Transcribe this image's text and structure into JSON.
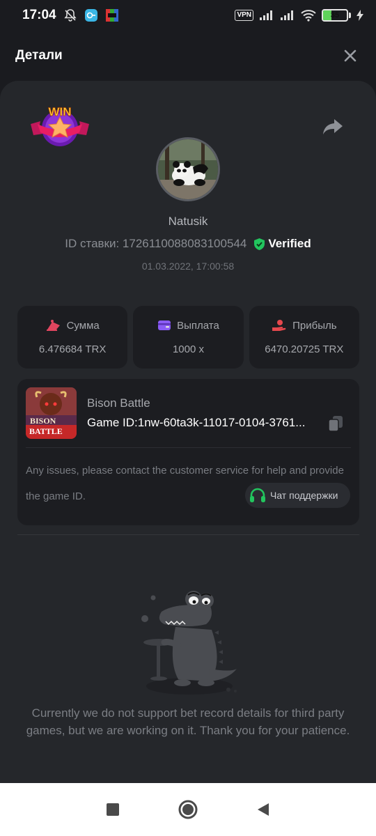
{
  "status_bar": {
    "time": "17:04",
    "vpn": "VPN",
    "battery": "35",
    "icons": [
      "mute-bell-icon",
      "app-notification-icon",
      "app-notification-icon",
      "signal-icon",
      "signal-icon",
      "wifi-icon",
      "battery-icon",
      "charging-icon"
    ]
  },
  "header": {
    "title": "Детали",
    "close_icon": "close-icon"
  },
  "badge": {
    "text": "WIN"
  },
  "profile": {
    "username": "Natusik",
    "bet_id_label": "ID ставки: 1726110088083100544",
    "verified": "Verified",
    "date": "01.03.2022, 17:00:58"
  },
  "stats": [
    {
      "label": "Сумма",
      "value": "6.476684 TRX",
      "icon": "cash-icon",
      "color": "#e0455f"
    },
    {
      "label": "Выплата",
      "value": "1000 x",
      "icon": "wallet-icon",
      "color": "#8b5cf6"
    },
    {
      "label": "Прибыль",
      "value": "6470.20725 TRX",
      "icon": "profit-hand-icon",
      "color": "#e5484d"
    }
  ],
  "game": {
    "name": "Bison Battle",
    "id_line": "Game ID:1nw-60ta3k-11017-0104-3761...",
    "thumb_text": [
      "BISON",
      "BATTLE"
    ],
    "issue_text": "Any issues, please contact the customer service for help and provide the game ID.",
    "support_label": "Чат поддержки"
  },
  "empty": {
    "message": "Currently we do not support bet record details for third party games, but we are working on it. Thank you for your patience."
  },
  "colors": {
    "background": "#1a1b1f",
    "sheet": "#25272b",
    "card": "#1c1d21",
    "verified_green": "#22c55e",
    "support_green": "#22c55e"
  },
  "nav": [
    "recent-apps-icon",
    "home-icon",
    "back-icon"
  ]
}
